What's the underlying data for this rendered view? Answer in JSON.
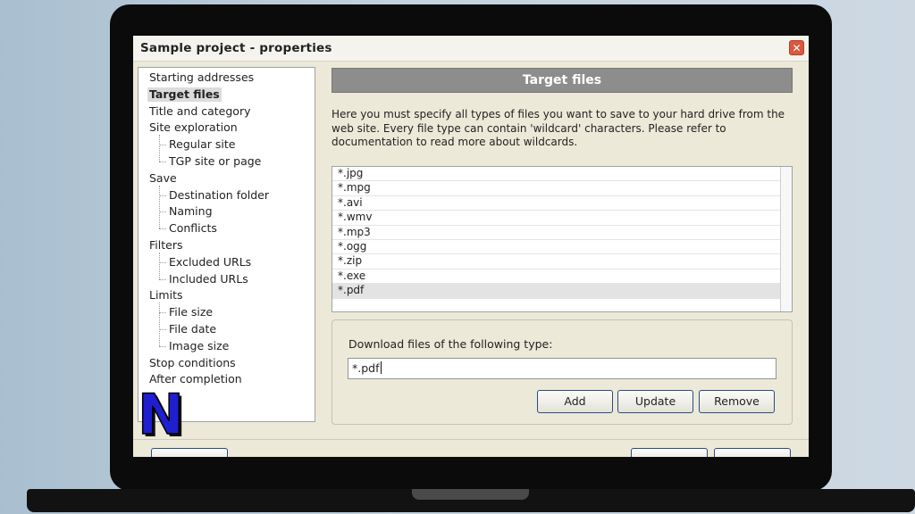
{
  "window": {
    "title": "Sample project - properties",
    "close_glyph": "✕"
  },
  "tree": {
    "items": [
      {
        "label": "Starting addresses",
        "level": 0
      },
      {
        "label": "Target files",
        "level": 0,
        "selected": true
      },
      {
        "label": "Title and category",
        "level": 0
      },
      {
        "label": "Site exploration",
        "level": 0
      },
      {
        "label": "Regular site",
        "level": 1
      },
      {
        "label": "TGP site or page",
        "level": 1
      },
      {
        "label": "Save",
        "level": 0
      },
      {
        "label": "Destination folder",
        "level": 1
      },
      {
        "label": "Naming",
        "level": 1
      },
      {
        "label": "Conflicts",
        "level": 1
      },
      {
        "label": "Filters",
        "level": 0
      },
      {
        "label": "Excluded URLs",
        "level": 1
      },
      {
        "label": "Included URLs",
        "level": 1
      },
      {
        "label": "Limits",
        "level": 0
      },
      {
        "label": "File size",
        "level": 1
      },
      {
        "label": "File date",
        "level": 1
      },
      {
        "label": "Image size",
        "level": 1
      },
      {
        "label": "Stop conditions",
        "level": 0
      },
      {
        "label": "After completion",
        "level": 0
      }
    ]
  },
  "main": {
    "header": "Target files",
    "description": "Here you must specify all types of files you want to save to your hard drive from the web site. Every file type can contain 'wildcard' characters. Please refer to documentation to read more about wildcards.",
    "file_types": [
      "*.jpg",
      "*.mpg",
      "*.avi",
      "*.wmv",
      "*.mp3",
      "*.ogg",
      "*.zip",
      "*.exe",
      "*.pdf"
    ],
    "selected_file_type": "*.pdf",
    "download_label": "Download files of the following type:",
    "download_value": "*.pdf",
    "buttons": {
      "add": "Add",
      "update": "Update",
      "remove": "Remove"
    }
  },
  "overlay": {
    "logo_letter": "N",
    "logo_color": "#1f1fd0"
  },
  "colors": {
    "header_bar": "#8d8d8d",
    "dialog_bg": "#ece9d8",
    "button_border": "#2b4b8a"
  }
}
